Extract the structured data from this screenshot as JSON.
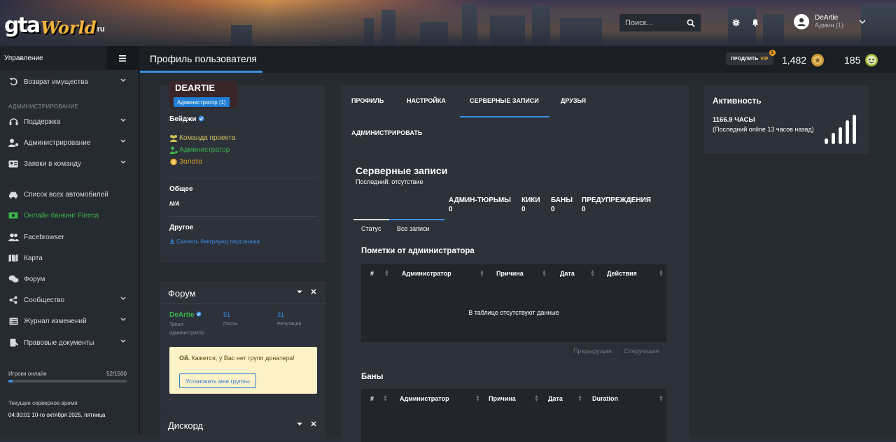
{
  "header": {
    "logo": {
      "g": "gta",
      "w": "World",
      "r": "ru"
    },
    "search_placeholder": "Поиск...",
    "user": {
      "name": "DeArtie",
      "role": "Админ (1)"
    }
  },
  "sidebar": {
    "title": "Управление",
    "items": [
      {
        "label": "Возврат имущества",
        "icon": "undo-icon",
        "chevron": true
      },
      {
        "label": "Поддержка",
        "icon": "headset-icon",
        "chevron": true
      },
      {
        "label": "Администрирование",
        "icon": "user-cog-icon",
        "chevron": true
      },
      {
        "label": "Заявки в команду",
        "icon": "id-card-icon",
        "chevron": true
      },
      {
        "label": "Список всех автомобилей",
        "icon": "car-icon",
        "chevron": false
      },
      {
        "label": "Онлайн банкинг Fleeca",
        "icon": "money-icon",
        "chevron": false,
        "color": "#3bb34a"
      },
      {
        "label": "Facebrowser",
        "icon": "users-icon",
        "chevron": false
      },
      {
        "label": "Карта",
        "icon": "map-icon",
        "chevron": false
      },
      {
        "label": "Форум",
        "icon": "comments-icon",
        "chevron": false
      },
      {
        "label": "Сообщество",
        "icon": "share-icon",
        "chevron": true
      },
      {
        "label": "Журнал изменений",
        "icon": "list-icon",
        "chevron": true
      },
      {
        "label": "Правовые документы",
        "icon": "gavel-icon",
        "chevron": true
      }
    ],
    "section_admin": "АДМИНИСТРИРОВАНИЕ",
    "online_label": "Игроки онлайн",
    "online_value": "52/1500",
    "online_fraction": 0.035,
    "time_label": "Текущее серверное время",
    "time_value": "04:30:01 10-го октября 2025, пятница"
  },
  "topbar": {
    "title": "Профиль пользователя",
    "vip_prefix": "ПРОДЛИТЬ",
    "vip_label": "VIP",
    "vip_badge": "$",
    "coins": "1,482",
    "points": "185"
  },
  "profile": {
    "name": "DEARTIE",
    "role": "Администратор (1)",
    "badges_label": "Бейджи",
    "badges": [
      {
        "label": "Команда проекта",
        "color": "#d4c35a"
      },
      {
        "label": "Администратор",
        "color": "#3bb34a"
      },
      {
        "label": "Золото",
        "color": "#e0a82a"
      }
    ],
    "general_label": "Общее",
    "general_value": "N/A",
    "other_label": "Другое",
    "download_link": "Скачать бекграунд персонажа"
  },
  "forum": {
    "title": "Форум",
    "user": "DeArtie",
    "user_role": "Триал-администратор",
    "posts_value": "51",
    "posts_label": "Посты",
    "rep_value": "31",
    "rep_label": "Репутация",
    "warn_bold": "Ой.",
    "warn_text": " Кажется, у Вас нет групп донатера!",
    "warn_button": "Установить мне группы"
  },
  "discord": {
    "title": "Дискорд"
  },
  "records": {
    "tabs": [
      "ПРОФИЛЬ",
      "НАСТРОЙКА",
      "СЕРВЕРНЫЕ ЗАПИСИ",
      "ДРУЗЬЯ",
      "АДМИНИСТРИРОВАТЬ"
    ],
    "title": "Серверные записи",
    "last_seen": "Последний: отсутствие",
    "counters": [
      {
        "label": "АДМИН-ТЮРЬМЫ",
        "value": "0"
      },
      {
        "label": "КИКИ",
        "value": "0"
      },
      {
        "label": "БАНЫ",
        "value": "0"
      },
      {
        "label": "ПРЕДУПРЕЖДЕНИЯ",
        "value": "0"
      }
    ],
    "subtabs": [
      "Статус",
      "Все записи"
    ],
    "notes_title": "Пометки от администратора",
    "notes_cols": [
      "#",
      "Администратор",
      "Причина",
      "Дата",
      "Действия"
    ],
    "empty": "В таблице отсутствуют данные",
    "prev": "Предыдущая",
    "next": "Следующая",
    "bans_title": "Баны",
    "bans_cols": [
      "#",
      "Администратор",
      "Причина",
      "Дата",
      "Duration"
    ]
  },
  "activity": {
    "title": "Активность",
    "hours": "1166.9 ЧАСЫ",
    "last_online": "(Последний online 13 часов назад)"
  },
  "colors": {
    "accent": "#3b8fe3",
    "gold": "#f0b233",
    "green": "#3bb34a"
  }
}
